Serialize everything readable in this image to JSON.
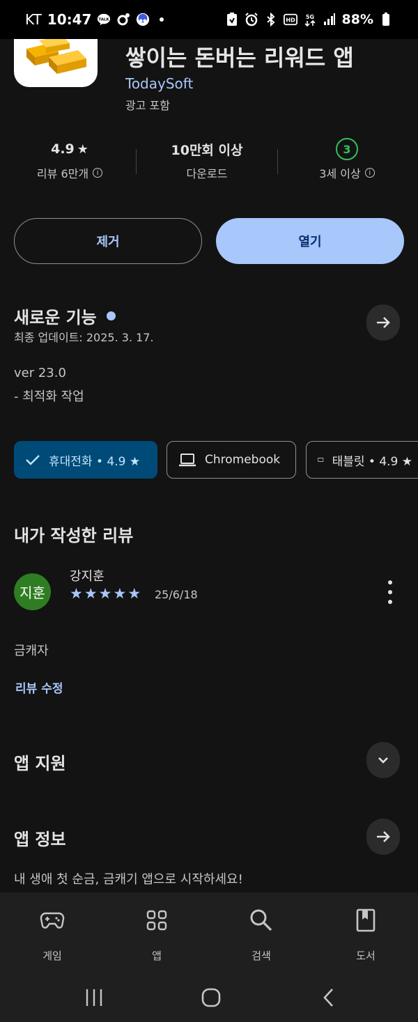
{
  "status_bar": {
    "carrier": "KT",
    "time": "10:47",
    "talk_badge": "TALK",
    "battery": "88%"
  },
  "app": {
    "title": "쌓이는 돈버는 리워드 앱",
    "developer": "TodaySoft",
    "ads_note": "광고 포함",
    "icon": "gold-bars-icon"
  },
  "stats": {
    "rating": "4.9",
    "reviews": "리뷰 6만개",
    "downloads": "10만회 이상",
    "downloads_label": "다운로드",
    "age_badge": "3",
    "age_label": "3세 이상"
  },
  "buttons": {
    "remove": "제거",
    "open": "열기"
  },
  "whats_new": {
    "title": "새로운 기능",
    "updated": "최종 업데이트: 2025. 3. 17.",
    "version": "ver 23.0",
    "note": "- 최적화 작업"
  },
  "device_chips": [
    {
      "label": "휴대전화 • 4.9 ★",
      "selected": true
    },
    {
      "label": "Chromebook",
      "selected": false
    },
    {
      "label": "태블릿 • 4.9 ★",
      "selected": false
    }
  ],
  "my_review": {
    "title": "내가 작성한 리뷰",
    "avatar_text": "지훈",
    "reviewer": "강지훈",
    "stars": 5,
    "date": "25/6/18",
    "text": "금캐자",
    "edit": "리뷰 수정"
  },
  "app_support": {
    "title": "앱 지원"
  },
  "app_info": {
    "title": "앱 정보",
    "description": "내 생애 첫 순금, 금캐기 앱으로 시작하세요!"
  },
  "bottom_nav": [
    {
      "label": "게임",
      "icon": "gamepad-icon"
    },
    {
      "label": "앱",
      "icon": "apps-grid-icon"
    },
    {
      "label": "검색",
      "icon": "search-icon"
    },
    {
      "label": "도서",
      "icon": "book-icon"
    }
  ],
  "colors": {
    "accent": "#a8c7fa",
    "background": "#131313",
    "chip_selected": "#004a77",
    "age_green": "#37be5f",
    "avatar_green": "#2e7d22"
  }
}
